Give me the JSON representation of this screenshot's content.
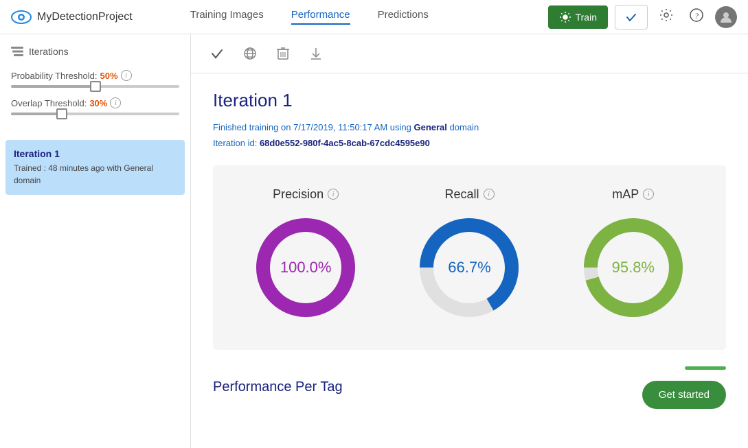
{
  "header": {
    "logo_alt": "eye-icon",
    "project_name": "MyDetectionProject",
    "nav": [
      {
        "label": "Training Images",
        "active": false
      },
      {
        "label": "Performance",
        "active": true
      },
      {
        "label": "Predictions",
        "active": false
      }
    ],
    "btn_train_label": "Train",
    "btn_publish_label": "✓",
    "settings_icon": "⚙",
    "help_icon": "?",
    "avatar_icon": "👤"
  },
  "sidebar": {
    "title": "Iterations",
    "probability_threshold": {
      "label": "Probability Threshold:",
      "value": "50%"
    },
    "overlap_threshold": {
      "label": "Overlap Threshold:",
      "value": "30%"
    },
    "iterations": [
      {
        "name": "Iteration 1",
        "desc": "Trained : 48 minutes ago with General domain",
        "active": true
      }
    ]
  },
  "toolbar": {
    "check_label": "✓",
    "globe_label": "🌐",
    "delete_label": "🗑",
    "download_label": "⬇"
  },
  "content": {
    "iteration_title": "Iteration 1",
    "training_info": "Finished training on 7/17/2019, 11:50:17 AM using",
    "training_domain": "General",
    "training_suffix": "domain",
    "iteration_id_label": "Iteration id:",
    "iteration_id_value": "68d0e552-980f-4ac5-8cab-67cdc4595e90",
    "metrics": [
      {
        "label": "Precision",
        "value": "100.0%",
        "color": "#9c27b0",
        "pct": 100,
        "id": "precision"
      },
      {
        "label": "Recall",
        "value": "66.7%",
        "color": "#1565c0",
        "pct": 66.7,
        "id": "recall"
      },
      {
        "label": "mAP",
        "value": "95.8%",
        "color": "#7cb342",
        "pct": 95.8,
        "id": "map"
      }
    ],
    "perf_per_tag_label": "Performance Per Tag",
    "get_started_label": "Get started"
  }
}
